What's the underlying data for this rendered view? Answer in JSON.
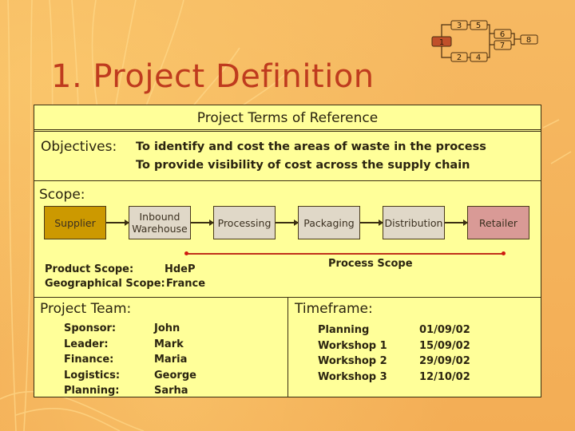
{
  "title": "1. Project Definition",
  "flow_diagram": {
    "nodes": [
      "1",
      "2",
      "3",
      "4",
      "5",
      "6",
      "7",
      "8"
    ],
    "active_node": "1"
  },
  "panel": {
    "header": "Project Terms of Reference",
    "objectives": {
      "label": "Objectives:",
      "items": [
        "To identify and cost the areas of waste in the process",
        "To provide visibility of cost across the supply chain"
      ]
    },
    "scope": {
      "label": "Scope:",
      "chain": [
        "Supplier",
        "Inbound Warehouse",
        "Processing",
        "Packaging",
        "Distribution",
        "Retailer"
      ],
      "process_scope_label": "Process Scope",
      "product_scope_label": "Product Scope:",
      "product_scope_value": "HdeP",
      "geo_scope_label": "Geographical Scope:",
      "geo_scope_value": "France"
    },
    "team": {
      "label": "Project Team:",
      "members": [
        {
          "role": "Sponsor:",
          "name": "John"
        },
        {
          "role": "Leader:",
          "name": "Mark"
        },
        {
          "role": "Finance:",
          "name": "Maria"
        },
        {
          "role": "Logistics:",
          "name": "George"
        },
        {
          "role": "Planning:",
          "name": "Sarha"
        }
      ]
    },
    "timeframe": {
      "label": "Timeframe:",
      "milestones": [
        {
          "name": "Planning",
          "date": "01/09/02"
        },
        {
          "name": "Workshop 1",
          "date": "15/09/02"
        },
        {
          "name": "Workshop 2",
          "date": "29/09/02"
        },
        {
          "name": "Workshop 3",
          "date": "12/10/02"
        }
      ]
    }
  },
  "colors": {
    "background": "#f5b55a",
    "title": "#bf3b1e",
    "panel": "#ffff99",
    "supplier": "#cc9900",
    "retailer": "#d99a96",
    "process_box": "#e0d8c8",
    "scope_line": "#c0301a"
  }
}
